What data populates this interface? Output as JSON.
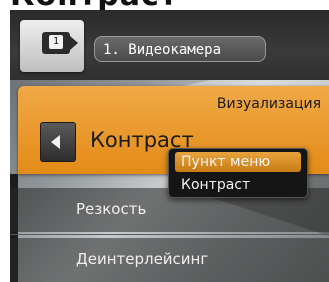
{
  "page": {
    "heading_fragment": "Контраст"
  },
  "camera": {
    "icon": "video-camera-icon",
    "number": "1",
    "name_button_label": "1. Видеокамера"
  },
  "panel": {
    "category": "Визуализация",
    "title": "Контраст",
    "back_icon": "chevron-left-icon",
    "accent_color": "#e8961f"
  },
  "tooltip": {
    "header": "Пункт меню",
    "value": "Контраст"
  },
  "menu": {
    "items": [
      {
        "label": "Резкость"
      },
      {
        "label": "Деинтерлейсинг"
      }
    ]
  }
}
